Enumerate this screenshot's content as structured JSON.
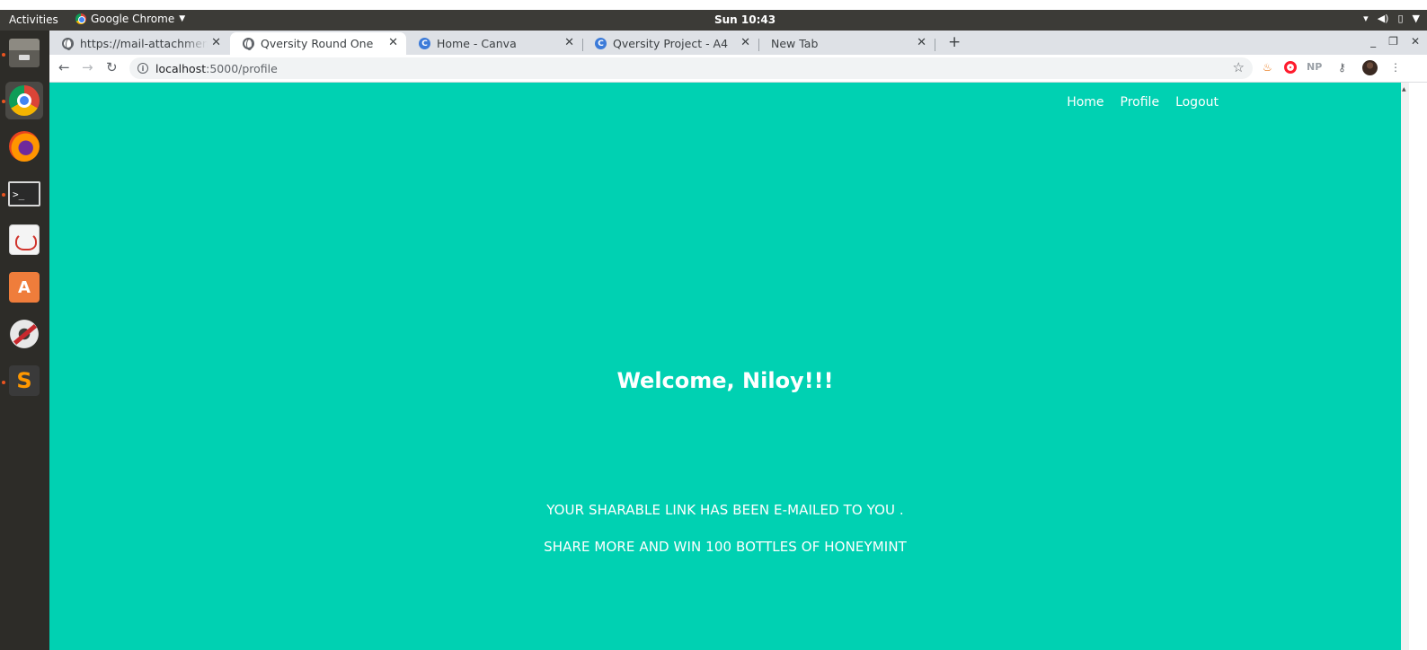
{
  "os": {
    "activities": "Activities",
    "app_menu": "Google Chrome",
    "clock": "Sun 10:43"
  },
  "browser": {
    "tabs": [
      {
        "label": "https://mail-attachment.googleusercontent.com",
        "icon": "globe-icon",
        "active": false
      },
      {
        "label": "Qversity Round One",
        "icon": "globe-icon",
        "active": true
      },
      {
        "label": "Home - Canva",
        "icon": "canva-icon",
        "active": false
      },
      {
        "label": "Qversity Project - A4",
        "icon": "canva-icon",
        "active": false
      },
      {
        "label": "New Tab",
        "icon": "",
        "active": false
      }
    ],
    "url_host": "localhost",
    "url_path": ":5000/profile",
    "ext_np": "NP"
  },
  "page": {
    "nav": {
      "home": "Home",
      "profile": "Profile",
      "logout": "Logout"
    },
    "welcome": "Welcome, Niloy!!!",
    "message_1": "YOUR SHARABLE LINK HAS BEEN E-MAILED TO YOU .",
    "message_2": "SHARE MORE AND WIN 100 BOTTLES OF HONEYMINT",
    "background_color": "#00d1b2"
  }
}
